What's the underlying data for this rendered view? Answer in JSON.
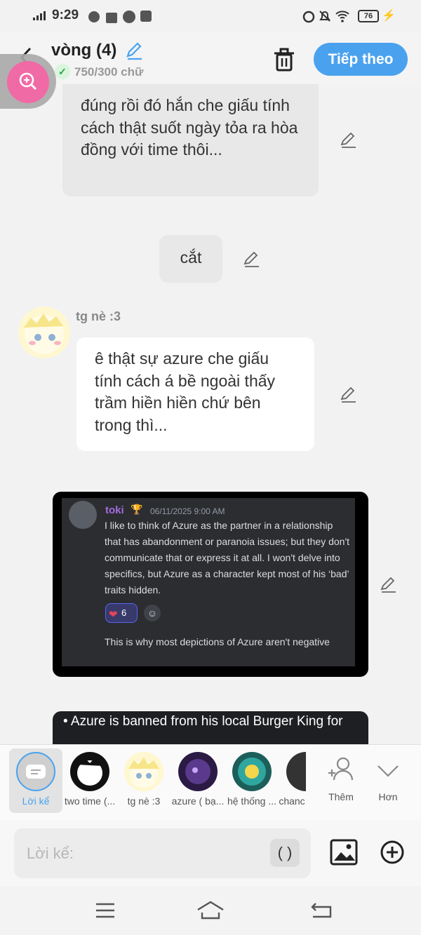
{
  "status": {
    "time": "9:29",
    "battery": "76"
  },
  "header": {
    "title": "vòng (4)",
    "word_count": "750/300 chữ",
    "next_label": "Tiếp theo"
  },
  "messages": {
    "m1": "đúng rồi đó hắn che giấu tính cách thật suốt ngày tỏa ra hòa đồng với time thôi...",
    "m2": "cắt",
    "m3_sender": "tg nè :3",
    "m3": "ê thật sự azure che giấu tính cách á bề ngoài thấy trầm hiền hiền chứ bên trong thì..."
  },
  "image_message": {
    "username": "toki",
    "timestamp": "06/11/2025 9:00 AM",
    "text": "I like to think of Azure as the partner in a relationship that has abandonment or paranoia issues; but they don't communicate that or express it at all. I won't delve into specifics, but Azure as a character kept most of his ‘bad’ traits hidden.",
    "reaction_count": "6",
    "text2": "This is why most depictions of Azure aren't negative"
  },
  "image_message2": {
    "text": "Azure is banned from his local Burger King for"
  },
  "characters": [
    {
      "label": "Lời kể"
    },
    {
      "label": "two time (..."
    },
    {
      "label": "tg nè :3"
    },
    {
      "label": "azure ( bạ..."
    },
    {
      "label": "hệ thống ..."
    },
    {
      "label": "chanc"
    }
  ],
  "char_actions": {
    "add_label": "Thêm",
    "more_label": "Hơn"
  },
  "input": {
    "placeholder": "Lời kể:",
    "paren": "( )"
  },
  "colors": {
    "accent": "#4aa2ef",
    "zoom": "#f06aa6"
  }
}
